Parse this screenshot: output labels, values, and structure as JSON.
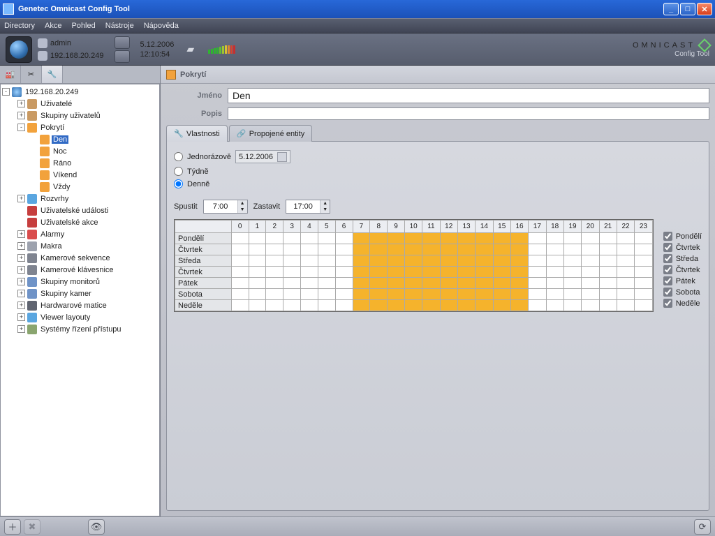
{
  "window": {
    "title": "Genetec Omnicast Config Tool"
  },
  "menu": {
    "items": [
      "Directory",
      "Akce",
      "Pohled",
      "Nástroje",
      "Nápověda"
    ]
  },
  "session": {
    "user": "admin",
    "host": "192.168.20.249",
    "date": "5.12.2006",
    "time": "12:10:54"
  },
  "brand": {
    "name": "OMNICAST",
    "sub": "Config Tool"
  },
  "tree": {
    "root": "192.168.20.249",
    "items": [
      {
        "label": "Uživatelé",
        "icon": "#c99a63",
        "exp": "+",
        "indent": 1
      },
      {
        "label": "Skupiny uživatelů",
        "icon": "#c99a63",
        "exp": "+",
        "indent": 1
      },
      {
        "label": "Pokrytí",
        "icon": "#f2a23c",
        "exp": "-",
        "indent": 1
      },
      {
        "label": "Den",
        "icon": "#f2a23c",
        "indent": 2,
        "selected": true
      },
      {
        "label": "Noc",
        "icon": "#f2a23c",
        "indent": 2
      },
      {
        "label": "Ráno",
        "icon": "#f2a23c",
        "indent": 2
      },
      {
        "label": "Víkend",
        "icon": "#f2a23c",
        "indent": 2
      },
      {
        "label": "Vždy",
        "icon": "#f2a23c",
        "indent": 2
      },
      {
        "label": "Rozvrhy",
        "icon": "#5aa6e0",
        "exp": "+",
        "indent": 1
      },
      {
        "label": "Uživatelské události",
        "icon": "#c63e3e",
        "indent": 1
      },
      {
        "label": "Uživatelské akce",
        "icon": "#c63e3e",
        "indent": 1
      },
      {
        "label": "Alarmy",
        "icon": "#d94c4c",
        "exp": "+",
        "indent": 1
      },
      {
        "label": "Makra",
        "icon": "#9da2ae",
        "exp": "+",
        "indent": 1
      },
      {
        "label": "Kamerové sekvence",
        "icon": "#7f8490",
        "exp": "+",
        "indent": 1
      },
      {
        "label": "Kamerové klávesnice",
        "icon": "#7f8490",
        "exp": "+",
        "indent": 1
      },
      {
        "label": "Skupiny monitorů",
        "icon": "#6f93c7",
        "exp": "+",
        "indent": 1
      },
      {
        "label": "Skupiny kamer",
        "icon": "#6f93c7",
        "exp": "+",
        "indent": 1
      },
      {
        "label": "Hardwarové matice",
        "icon": "#5f6470",
        "exp": "+",
        "indent": 1
      },
      {
        "label": "Viewer layouty",
        "icon": "#5aa6e0",
        "exp": "+",
        "indent": 1
      },
      {
        "label": "Systémy řízení přístupu",
        "icon": "#8aa56f",
        "exp": "+",
        "indent": 1
      }
    ]
  },
  "content": {
    "header": "Pokrytí",
    "name_label": "Jméno",
    "name_value": "Den",
    "desc_label": "Popis",
    "desc_value": "",
    "tabs": {
      "props": "Vlastnosti",
      "linked": "Propojené entity"
    },
    "recur": {
      "once": "Jednorázově",
      "weekly": "Týdně",
      "daily": "Denně",
      "once_date": "5.12.2006"
    },
    "time": {
      "start_label": "Spustit",
      "start": "7:00",
      "stop_label": "Zastavit",
      "stop": "17:00"
    },
    "hours": [
      "0",
      "1",
      "2",
      "3",
      "4",
      "5",
      "6",
      "7",
      "8",
      "9",
      "10",
      "11",
      "12",
      "13",
      "14",
      "15",
      "16",
      "17",
      "18",
      "19",
      "20",
      "21",
      "22",
      "23"
    ],
    "days": [
      "Pondělí",
      "Čtvrtek",
      "Středa",
      "Čtvrtek",
      "Pátek",
      "Sobota",
      "Neděle"
    ],
    "range": {
      "from": 7,
      "to": 17
    }
  }
}
